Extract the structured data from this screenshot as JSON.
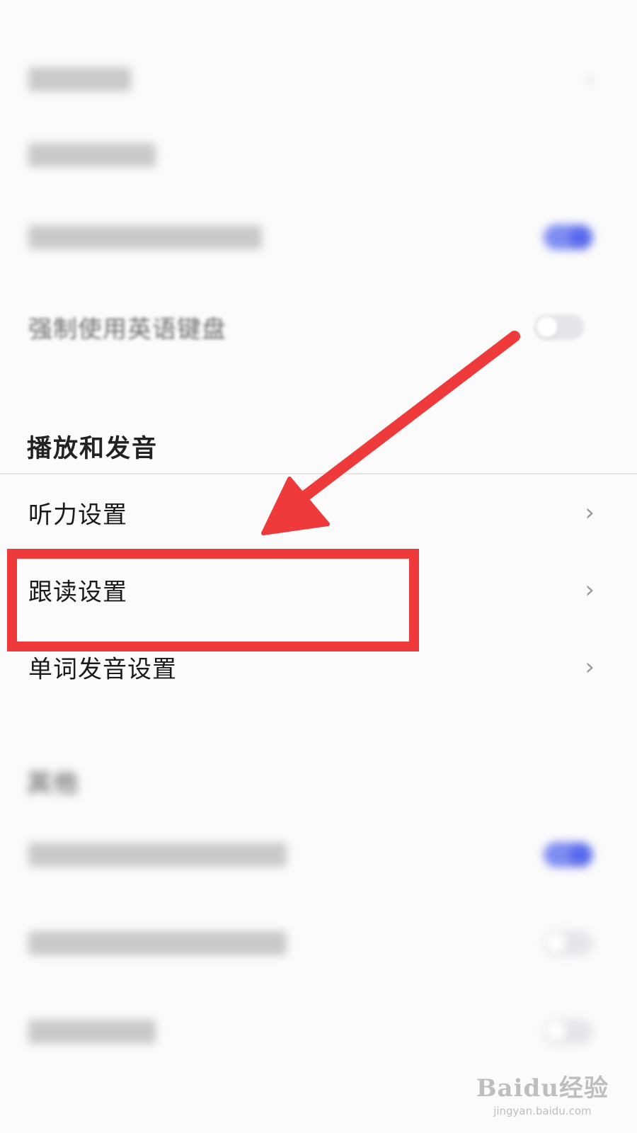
{
  "sections": [
    {
      "title": "",
      "items": [
        {
          "label": "",
          "control": "chevron",
          "blurred": true
        },
        {
          "label": "",
          "control": "none",
          "blurred": true
        },
        {
          "label": "",
          "control": "toggle",
          "on": true,
          "blurred": true
        },
        {
          "label": "强制使用英语键盘",
          "control": "toggle",
          "on": false,
          "blurred": true
        }
      ]
    },
    {
      "title": "播放和发音",
      "items": [
        {
          "label": "听力设置",
          "control": "chevron"
        },
        {
          "label": "跟读设置",
          "control": "chevron",
          "highlighted": true
        },
        {
          "label": "单词发音设置",
          "control": "chevron"
        }
      ]
    },
    {
      "title": "其他",
      "blurred": true,
      "items": [
        {
          "label": "",
          "control": "toggle",
          "on": true,
          "blurred": true
        },
        {
          "label": "",
          "control": "toggle",
          "on": false,
          "blurred": true
        },
        {
          "label": "",
          "control": "toggle",
          "on": false,
          "blurred": true
        }
      ]
    }
  ],
  "icons": {
    "chevron": "›"
  },
  "annotation": {
    "arrow_color": "#ee3a3a",
    "box_color": "#ee3a3a"
  },
  "colors": {
    "toggle_on": "#5869ee",
    "background": "#fbfbfb"
  },
  "watermark": {
    "logo": "Baidu经验",
    "url": "jingyan.baidu.com"
  }
}
